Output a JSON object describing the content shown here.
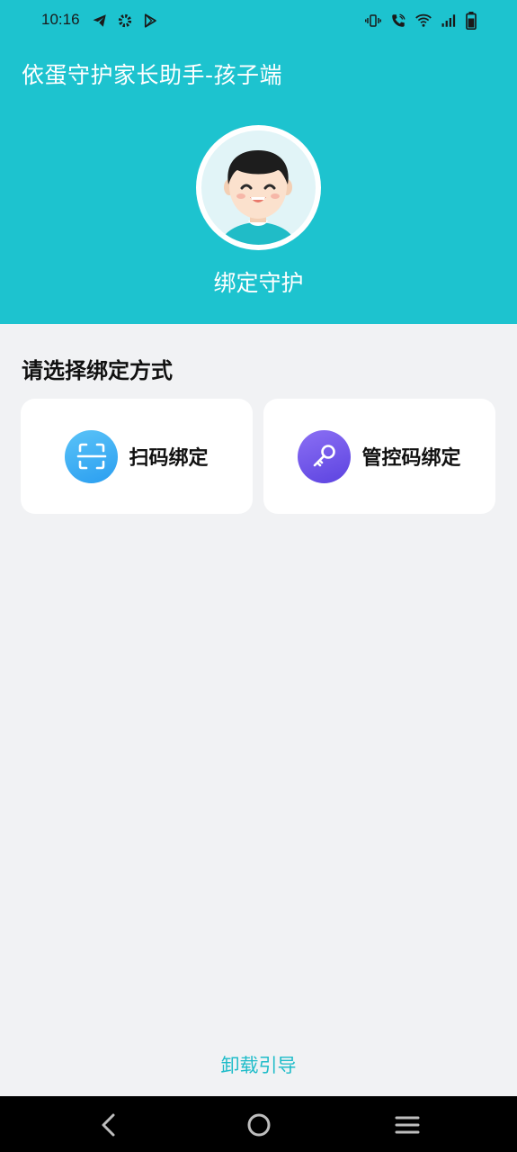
{
  "status_bar": {
    "time": "10:16",
    "left_icons": [
      "telegram-icon",
      "gear-icon",
      "play-store-icon"
    ],
    "right_icons": [
      "vibrate-icon",
      "wifi-call-icon",
      "wifi-icon",
      "signal-icon",
      "battery-icon"
    ]
  },
  "header": {
    "title": "依蛋守护家长助手-孩子端",
    "avatar_icon": "child-avatar-icon",
    "bind_label": "绑定守护",
    "color": "#1dc3cf"
  },
  "main": {
    "section_title": "请选择绑定方式",
    "options": [
      {
        "label": "扫码绑定",
        "icon": "scan-icon",
        "color": "#2a9ef0"
      },
      {
        "label": "管控码绑定",
        "icon": "key-icon",
        "color": "#5c43e0"
      }
    ]
  },
  "footer": {
    "uninstall_label": "卸载引导",
    "accent": "#1fbcc9"
  },
  "nav_bar": {
    "buttons": [
      "back-icon",
      "home-icon",
      "menu-icon"
    ]
  }
}
